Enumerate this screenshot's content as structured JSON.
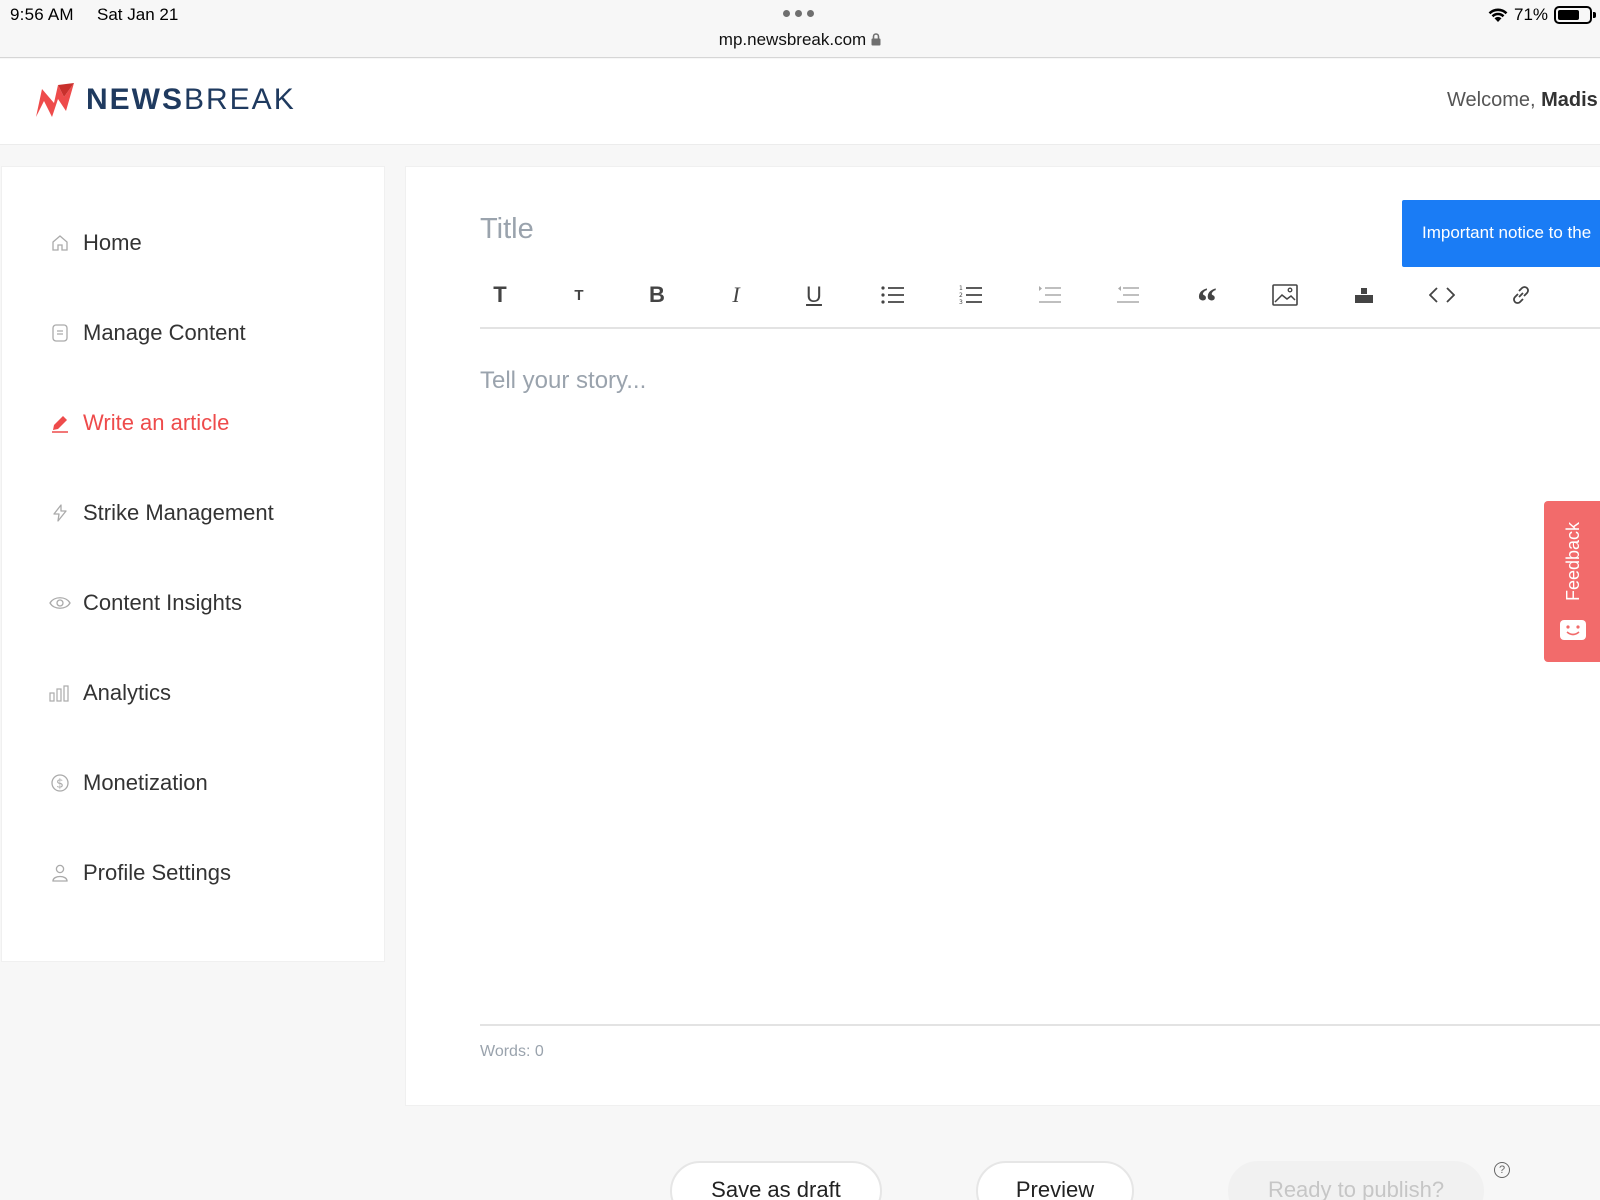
{
  "status_bar": {
    "time": "9:56 AM",
    "date": "Sat Jan 21",
    "url": "mp.newsbreak.com",
    "battery_pct": "71%",
    "battery_level": 0.71
  },
  "header": {
    "logo_bold": "NEWS",
    "logo_light": "BREAK",
    "welcome_prefix": "Welcome,",
    "welcome_name": "Madis"
  },
  "sidebar": {
    "items": [
      {
        "label": "Home",
        "icon": "home-icon"
      },
      {
        "label": "Manage Content",
        "icon": "document-icon"
      },
      {
        "label": "Write an article",
        "icon": "pencil-icon",
        "active": true
      },
      {
        "label": "Strike Management",
        "icon": "lightning-icon"
      },
      {
        "label": "Content Insights",
        "icon": "eye-icon"
      },
      {
        "label": "Analytics",
        "icon": "bar-chart-icon"
      },
      {
        "label": "Monetization",
        "icon": "dollar-icon"
      },
      {
        "label": "Profile Settings",
        "icon": "user-icon"
      }
    ],
    "active_color": "#ee4b4b"
  },
  "editor": {
    "title_placeholder": "Title",
    "body_placeholder": "Tell your story...",
    "word_count": "Words: 0",
    "notice": "Important notice to the",
    "toolbar": {
      "heading_large": "T",
      "heading_small": "T",
      "bold": "B",
      "italic": "I",
      "underline": "U",
      "quote": "“"
    }
  },
  "feedback": {
    "label": "Feedback"
  },
  "actions": {
    "save_draft": "Save as draft",
    "preview": "Preview",
    "publish": "Ready to publish?",
    "help": "?"
  },
  "colors": {
    "accent_red": "#ee4b4b",
    "notice_blue": "#1a7cf5",
    "logo_navy": "#1f3a5f"
  }
}
